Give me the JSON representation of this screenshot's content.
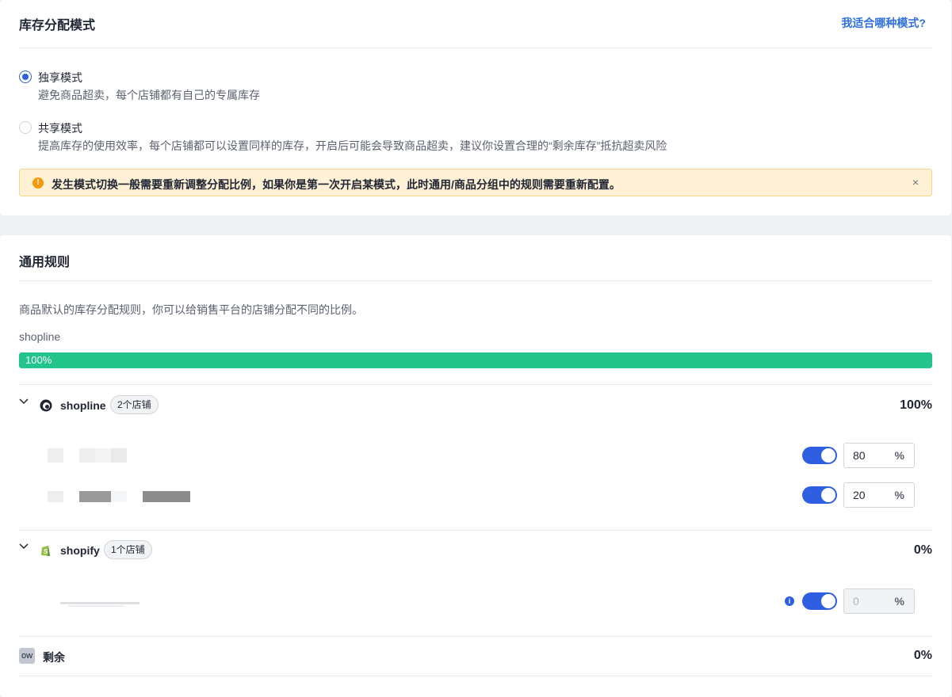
{
  "mode_section": {
    "title": "库存分配模式",
    "help_link": "我适合哪种模式?",
    "options": [
      {
        "label": "独享模式",
        "desc": "避免商品超卖，每个店铺都有自己的专属库存",
        "selected": true
      },
      {
        "label": "共享模式",
        "desc": "提高库存的使用效率，每个店铺都可以设置同样的库存，开启后可能会导致商品超卖，建议你设置合理的“剩余库存”抵抗超卖风险",
        "selected": false
      }
    ],
    "alert": {
      "icon": "warning-icon",
      "text": "发生模式切换一般需要重新调整分配比例，如果你是第一次开启某模式，此时通用/商品分组中的规则需要重新配置。",
      "close": "×"
    }
  },
  "rules_section": {
    "title": "通用规则",
    "description": "商品默认的库存分配规则，你可以给销售平台的店铺分配不同的比例。",
    "bar": {
      "label": "shopline",
      "value_label": "100%",
      "fill_percent": 100,
      "color": "#22c48b"
    },
    "groups": [
      {
        "platform": "shopline",
        "icon": "shopline-logo-icon",
        "store_count": "2个店铺",
        "percent": "100%",
        "stores": [
          {
            "name_visible": false,
            "enabled": true,
            "value": "80",
            "unit": "%"
          },
          {
            "name_visible": false,
            "enabled": true,
            "value": "20",
            "unit": "%"
          }
        ]
      },
      {
        "platform": "shopify",
        "icon": "shopify-logo-icon",
        "store_count": "1个店铺",
        "percent": "0%",
        "stores": [
          {
            "name_visible": false,
            "enabled": true,
            "value": "0",
            "unit": "%",
            "disabled": true,
            "has_info": true
          }
        ]
      }
    ],
    "remainder": {
      "badge": "ow",
      "label": "剩余",
      "percent": "0%"
    }
  },
  "colors": {
    "accent": "#2d5fe0",
    "link": "#2f6fdf",
    "success": "#22c48b",
    "warning_bg": "#fff1d6",
    "warning_icon": "#f59a0b"
  }
}
